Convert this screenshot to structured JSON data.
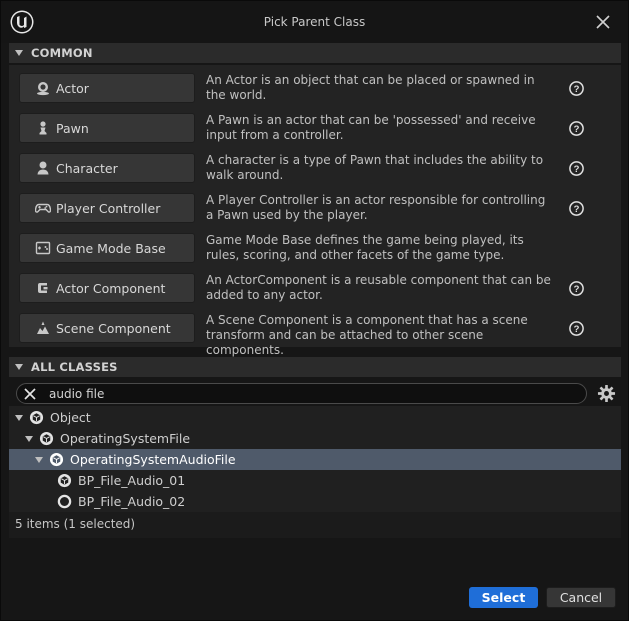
{
  "window": {
    "title": "Pick Parent Class"
  },
  "common": {
    "header": "COMMON",
    "classes": [
      {
        "label": "Actor",
        "icon": "actor-icon",
        "description": "An Actor is an object that can be placed or spawned in the world."
      },
      {
        "label": "Pawn",
        "icon": "pawn-icon",
        "description": "A Pawn is an actor that can be 'possessed' and receive input from a controller."
      },
      {
        "label": "Character",
        "icon": "character-icon",
        "description": "A character is a type of Pawn that includes the ability to walk around."
      },
      {
        "label": "Player Controller",
        "icon": "gamepad-icon",
        "description": "A Player Controller is an actor responsible for controlling a Pawn used by the player."
      },
      {
        "label": "Game Mode Base",
        "icon": "game-mode-icon",
        "description": "Game Mode Base defines the game being played, its rules, scoring, and other facets of the game type."
      },
      {
        "label": "Actor Component",
        "icon": "actor-component-icon",
        "description": "An ActorComponent is a reusable component that can be added to any actor."
      },
      {
        "label": "Scene Component",
        "icon": "scene-component-icon",
        "description": "A Scene Component is a component that has a scene transform and can be attached to other scene components."
      }
    ]
  },
  "all_classes": {
    "header": "ALL CLASSES",
    "search": {
      "value": "audio file"
    },
    "tree": [
      {
        "label": "Object",
        "icon": "class-icon"
      },
      {
        "label": "OperatingSystemFile",
        "icon": "class-icon"
      },
      {
        "label": "OperatingSystemAudioFile",
        "icon": "class-icon"
      },
      {
        "label": "BP_File_Audio_01",
        "icon": "class-icon"
      },
      {
        "label": "BP_File_Audio_02",
        "icon": "blueprint-ring-icon"
      }
    ],
    "status": "5 items (1 selected)"
  },
  "buttons": {
    "select": "Select",
    "cancel": "Cancel"
  },
  "colors": {
    "accent": "#1f6ed8",
    "selection": "#4f5a6a",
    "background": "#161616"
  }
}
